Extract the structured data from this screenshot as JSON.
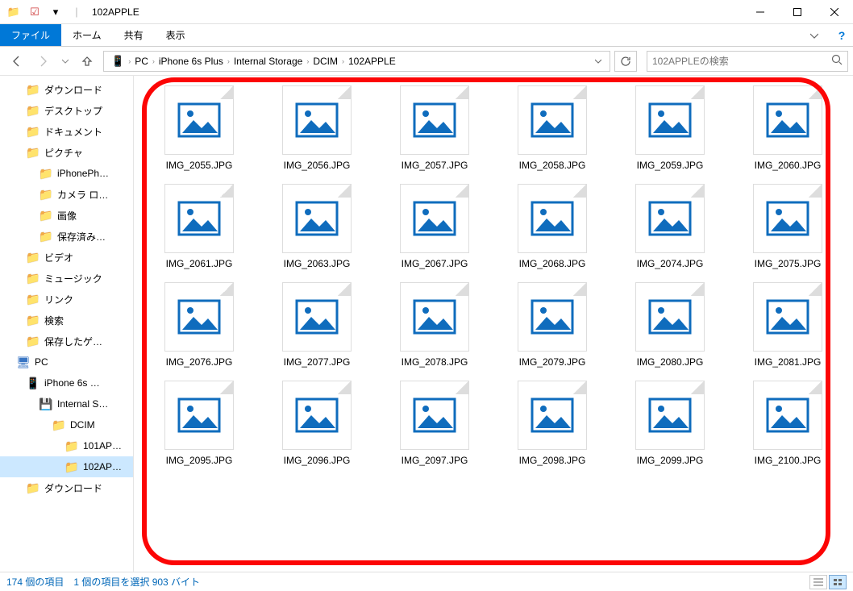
{
  "window_title": "102APPLE",
  "ribbon_tabs": {
    "file": "ファイル",
    "home": "ホーム",
    "share": "共有",
    "view": "表示"
  },
  "breadcrumbs": [
    "PC",
    "iPhone 6s Plus",
    "Internal Storage",
    "DCIM",
    "102APPLE"
  ],
  "search_placeholder": "102APPLEの検索",
  "tree_items": [
    {
      "label": "ダウンロード",
      "indent": 32,
      "icon": "folder"
    },
    {
      "label": "デスクトップ",
      "indent": 32,
      "icon": "folder"
    },
    {
      "label": "ドキュメント",
      "indent": 32,
      "icon": "folder"
    },
    {
      "label": "ピクチャ",
      "indent": 32,
      "icon": "folder"
    },
    {
      "label": "iPhonePh…",
      "indent": 48,
      "icon": "folder"
    },
    {
      "label": "カメラ ロ…",
      "indent": 48,
      "icon": "folder"
    },
    {
      "label": "画像",
      "indent": 48,
      "icon": "folder"
    },
    {
      "label": "保存済み…",
      "indent": 48,
      "icon": "folder"
    },
    {
      "label": "ビデオ",
      "indent": 32,
      "icon": "folder"
    },
    {
      "label": "ミュージック",
      "indent": 32,
      "icon": "folder"
    },
    {
      "label": "リンク",
      "indent": 32,
      "icon": "folder"
    },
    {
      "label": "検索",
      "indent": 32,
      "icon": "folder"
    },
    {
      "label": "保存したゲ…",
      "indent": 32,
      "icon": "folder"
    },
    {
      "label": "PC",
      "indent": 20,
      "icon": "pc"
    },
    {
      "label": "iPhone 6s …",
      "indent": 32,
      "icon": "device"
    },
    {
      "label": "Internal S…",
      "indent": 48,
      "icon": "storage"
    },
    {
      "label": "DCIM",
      "indent": 64,
      "icon": "folder"
    },
    {
      "label": "101AP…",
      "indent": 80,
      "icon": "folder"
    },
    {
      "label": "102AP…",
      "indent": 80,
      "icon": "folder",
      "selected": true
    },
    {
      "label": "ダウンロード",
      "indent": 32,
      "icon": "folder"
    }
  ],
  "files": [
    "IMG_2055.JPG",
    "IMG_2056.JPG",
    "IMG_2057.JPG",
    "IMG_2058.JPG",
    "IMG_2059.JPG",
    "IMG_2060.JPG",
    "IMG_2061.JPG",
    "IMG_2063.JPG",
    "IMG_2067.JPG",
    "IMG_2068.JPG",
    "IMG_2074.JPG",
    "IMG_2075.JPG",
    "IMG_2076.JPG",
    "IMG_2077.JPG",
    "IMG_2078.JPG",
    "IMG_2079.JPG",
    "IMG_2080.JPG",
    "IMG_2081.JPG",
    "IMG_2095.JPG",
    "IMG_2096.JPG",
    "IMG_2097.JPG",
    "IMG_2098.JPG",
    "IMG_2099.JPG",
    "IMG_2100.JPG"
  ],
  "status": {
    "item_count": "174 個の項目",
    "selection": "1 個の項目を選択 903 バイト"
  }
}
